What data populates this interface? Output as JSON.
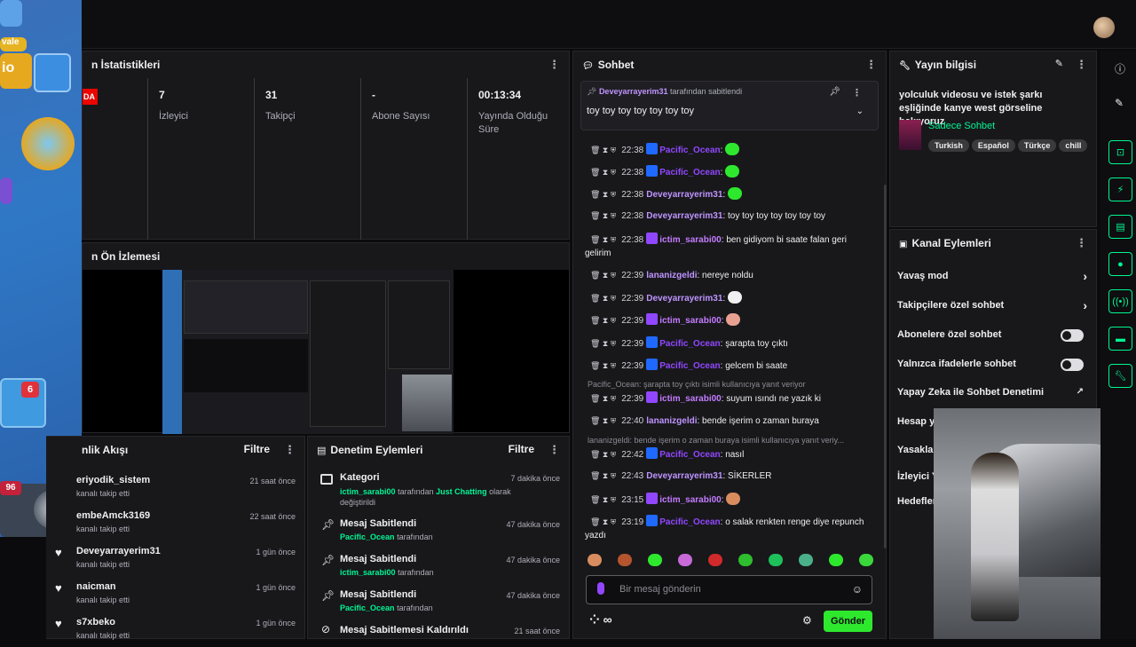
{
  "stats_panel": {
    "title": "n İstatistikleri",
    "live_badge": "DA",
    "stats": [
      {
        "value": "7",
        "label": "İzleyici"
      },
      {
        "value": "31",
        "label": "Takipçi"
      },
      {
        "value": "-",
        "label": "Abone Sayısı"
      },
      {
        "value": "00:13:34",
        "label": "Yayında Olduğu Süre"
      }
    ]
  },
  "preview_panel": {
    "title": "n Ön İzlemesi"
  },
  "activity_panel": {
    "title": "nlik Akışı",
    "filter_label": "Filtre",
    "items": [
      {
        "name": "eriyodik_sistem",
        "sub": "kanalı takip etti",
        "time": "21 saat önce"
      },
      {
        "name": "embeAmck3169",
        "sub": "kanalı takip etti",
        "time": "22 saat önce"
      },
      {
        "name": "Deveyarrayerim31",
        "sub": "kanalı takip etti",
        "time": "1 gün önce"
      },
      {
        "name": "naicman",
        "sub": "kanalı takip etti",
        "time": "1 gün önce"
      },
      {
        "name": "s7xbeko",
        "sub": "kanalı takip etti",
        "time": "1 gün önce"
      }
    ]
  },
  "mod_panel": {
    "title": "Denetim Eylemleri",
    "filter_label": "Filtre",
    "items": [
      {
        "title": "Kategori",
        "who": "ictim_sarabi00",
        "mid": "tarafından",
        "target": "Just Chatting",
        "rest": "olarak değiştirildi",
        "time": "7 dakika önce"
      },
      {
        "title": "Mesaj Sabitlendi",
        "who": "Pacific_Ocean",
        "mid": "tarafından",
        "time": "47 dakika önce"
      },
      {
        "title": "Mesaj Sabitlendi",
        "who": "ictim_sarabi00",
        "mid": "tarafından",
        "time": "47 dakika önce"
      },
      {
        "title": "Mesaj Sabitlendi",
        "who": "Pacific_Ocean",
        "mid": "tarafından",
        "time": "47 dakika önce"
      },
      {
        "title": "Mesaj Sabitlemesi Kaldırıldı",
        "time": "21 saat önce"
      }
    ]
  },
  "chat": {
    "title": "Sohbet",
    "pinned_by": "Deveyarrayerim31",
    "pinned_suffix": "tarafından sabitlendi",
    "pinned_text": "toy toy toy toy toy toy toy",
    "messages": [
      {
        "time": "22:38",
        "user": "Pacific_Ocean",
        "text": ""
      },
      {
        "time": "22:38",
        "user": "Pacific_Ocean",
        "text": ""
      },
      {
        "time": "22:38",
        "user": "Deveyarrayerim31",
        "text": ""
      },
      {
        "time": "22:38",
        "user": "Deveyarrayerim31",
        "text": "toy toy toy toy toy toy toy"
      },
      {
        "time": "22:38",
        "user": "ictim_sarabi00",
        "text": "ben gidiyom bi saate falan geri gelirim"
      },
      {
        "time": "22:39",
        "user": "lananizgeldi",
        "text": "nereye noldu"
      },
      {
        "time": "22:39",
        "user": "Deveyarrayerim31",
        "text": ""
      },
      {
        "time": "22:39",
        "user": "ictim_sarabi00",
        "text": ""
      },
      {
        "time": "22:39",
        "user": "Pacific_Ocean",
        "text": "şarapta toy çıktı"
      },
      {
        "time": "22:39",
        "user": "Pacific_Ocean",
        "text": "gelcem bi saate"
      },
      {
        "time": "22:39",
        "user": "ictim_sarabi00",
        "text": "suyum ısındı ne yazık ki"
      },
      {
        "time": "22:40",
        "user": "lananizgeldi",
        "text": "bende işerim o zaman buraya"
      },
      {
        "time": "22:42",
        "user": "Pacific_Ocean",
        "text": "nasıl"
      },
      {
        "time": "22:43",
        "user": "Deveyarrayerim31",
        "text": "SİKERLER"
      },
      {
        "time": "23:15",
        "user": "ictim_sarabi00",
        "text": ""
      },
      {
        "time": "23:19",
        "user": "Pacific_Ocean",
        "text": "o salak renkten renge diye repunch yazdı"
      }
    ],
    "reply1": "Pacific_Ocean: şarapta toy çıktı isimli kullanıcıya yanıt veriyor",
    "reply2": "lananizgeldi: bende işerim o zaman buraya isimli kullanıcıya yanıt veriy...",
    "input_placeholder": "Bir mesaj gönderin",
    "send_label": "Gönder",
    "points_label": "∞"
  },
  "stream_info": {
    "title": "Yayın bilgisi",
    "stream_title": "yolculuk videosu ve istek şarkı eşliğinde kanye west görseline bakıyoruz",
    "category": "Sadece Sohbet",
    "tags": [
      "Turkish",
      "Español",
      "Türkçe",
      "chill"
    ]
  },
  "channel_actions": {
    "title": "Kanal Eylemleri",
    "items": [
      {
        "label": "Yavaş mod"
      },
      {
        "label": "Takipçilere özel sohbet"
      },
      {
        "label": "Abonelere özel sohbet"
      },
      {
        "label": "Yalnızca ifadelerle sohbet"
      },
      {
        "label": "Yapay Zeka ile Sohbet Denetimi"
      },
      {
        "label": "Hesap y"
      },
      {
        "label": "Yasaklar"
      },
      {
        "label": "İzleyici Y"
      },
      {
        "label": "Hedefler"
      }
    ]
  },
  "game_overlay": {
    "badge_top": "vale",
    "badge_num": "io",
    "trophy_count": "6",
    "level": "96"
  },
  "colors": {
    "accent": "#9147ff",
    "green": "#00f593",
    "send": "#2ee82e"
  }
}
